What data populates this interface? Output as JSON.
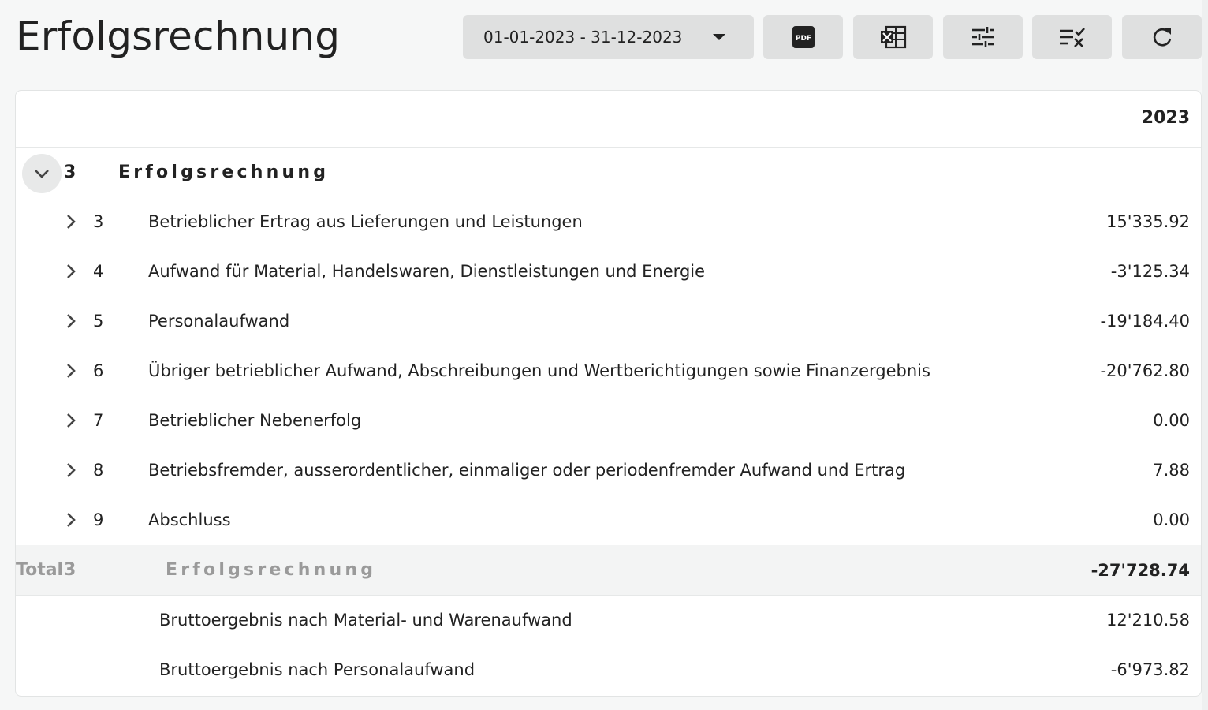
{
  "page": {
    "title": "Erfolgsrechnung"
  },
  "toolbar": {
    "date_range": "01-01-2023 - 31-12-2023",
    "buttons": [
      {
        "icon": "pdf-icon",
        "glyph": "PDF"
      },
      {
        "icon": "excel-icon"
      },
      {
        "icon": "sliders-icon"
      },
      {
        "icon": "clear-filter-icon"
      },
      {
        "icon": "refresh-icon"
      }
    ]
  },
  "table": {
    "column_year": "2023",
    "group": {
      "number": "3",
      "label": "Erfolgsrechnung",
      "expanded": true
    },
    "rows": [
      {
        "number": "3",
        "label": "Betrieblicher Ertrag aus Lieferungen und Leistungen",
        "amount": "15'335.92"
      },
      {
        "number": "4",
        "label": "Aufwand für Material, Handelswaren, Dienstleistungen und Energie",
        "amount": "-3'125.34"
      },
      {
        "number": "5",
        "label": "Personalaufwand",
        "amount": "-19'184.40"
      },
      {
        "number": "6",
        "label": "Übriger betrieblicher Aufwand, Abschreibungen und Wertberichtigungen sowie Finanzergebnis",
        "amount": "-20'762.80"
      },
      {
        "number": "7",
        "label": "Betrieblicher Nebenerfolg",
        "amount": "0.00"
      },
      {
        "number": "8",
        "label": "Betriebsfremder, ausserordentlicher, einmaliger oder periodenfremder Aufwand und Ertrag",
        "amount": "7.88"
      },
      {
        "number": "9",
        "label": "Abschluss",
        "amount": "0.00"
      }
    ],
    "total": {
      "number": "3",
      "prefix": "Total",
      "label": "Erfolgsrechnung",
      "amount": "-27'728.74"
    },
    "subtotals": [
      {
        "label": "Bruttoergebnis nach Material- und Warenaufwand",
        "amount": "12'210.58"
      },
      {
        "label": "Bruttoergebnis nach Personalaufwand",
        "amount": "-6'973.82"
      }
    ]
  },
  "colors": {
    "background": "#f6f7f7",
    "button_bg": "#dfe0e0",
    "total_row_bg": "#f3f4f4",
    "muted_text": "#9a9a9a"
  }
}
